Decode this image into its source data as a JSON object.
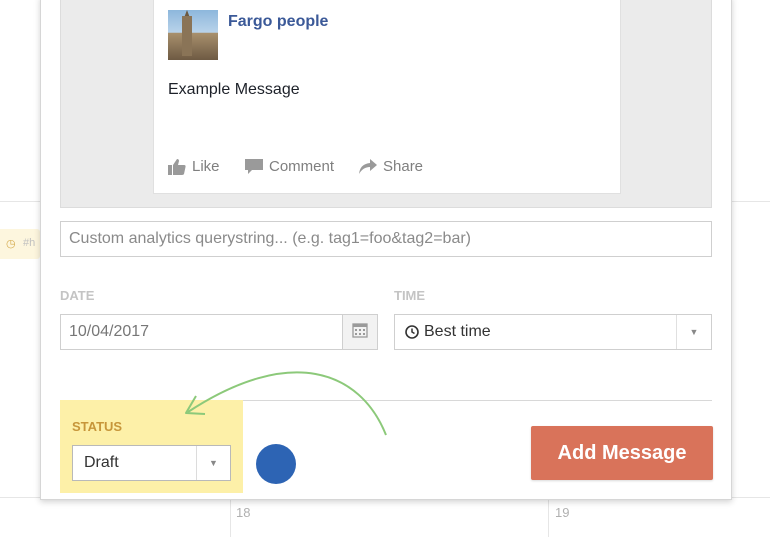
{
  "calendar": {
    "day_labels": [
      "18",
      "19"
    ],
    "chip_text": "#h",
    "chip_icon": "clock-icon"
  },
  "preview": {
    "page_name": "Fargo people",
    "message": "Example Message",
    "actions": [
      {
        "label": "Like",
        "icon": "thumbs-up-icon"
      },
      {
        "label": "Comment",
        "icon": "comment-icon"
      },
      {
        "label": "Share",
        "icon": "share-icon"
      }
    ]
  },
  "analytics": {
    "placeholder": "Custom analytics querystring... (e.g. tag1=foo&tag2=bar)",
    "value": ""
  },
  "date": {
    "label": "DATE",
    "value": "10/04/2017",
    "icon": "calendar-icon"
  },
  "time": {
    "label": "TIME",
    "value": "Best time",
    "icon": "clock-icon"
  },
  "status": {
    "label": "STATUS",
    "value": "Draft"
  },
  "add_button": {
    "label": "Add Message"
  },
  "colors": {
    "accent_button": "#d9735a",
    "status_highlight": "#fdf0a8",
    "facebook_blue": "#3b5998",
    "dot_blue": "#2d64b4",
    "arrow_green": "#8cc97a"
  }
}
